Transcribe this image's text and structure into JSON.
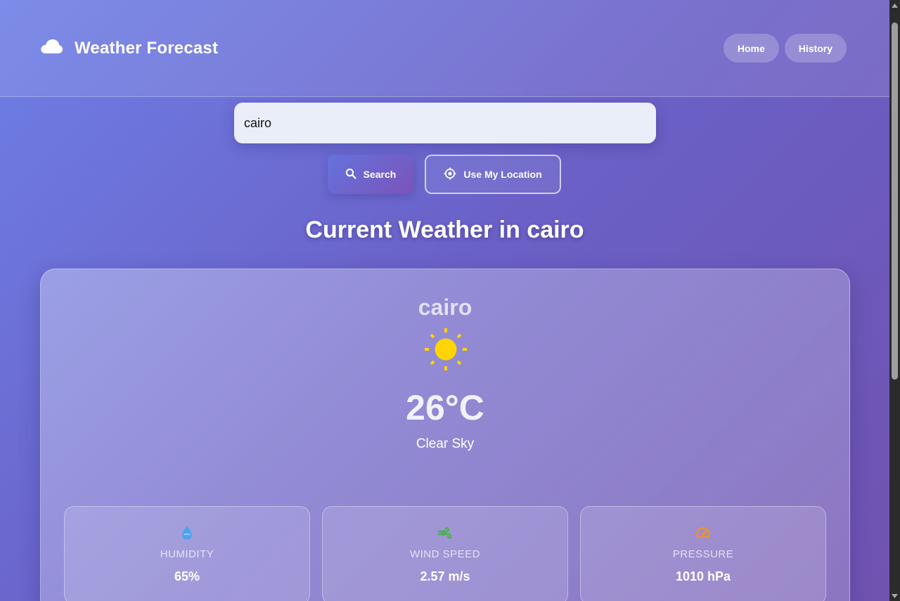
{
  "header": {
    "title": "Weather Forecast",
    "logo_icon": "cloud-icon",
    "nav": [
      {
        "label": "Home"
      },
      {
        "label": "History"
      }
    ]
  },
  "search": {
    "value": "cairo",
    "search_label": "Search",
    "location_label": "Use My Location"
  },
  "heading": "Current Weather in cairo",
  "current": {
    "city": "cairo",
    "icon": "sun-icon",
    "temperature": "26°C",
    "description": "Clear Sky"
  },
  "stats": [
    {
      "icon": "humidity-drop-icon",
      "label": "HUMIDITY",
      "value": "65%",
      "color": "#4aa3f0"
    },
    {
      "icon": "wind-icon",
      "label": "WIND SPEED",
      "value": "2.57 m/s",
      "color": "#4caf50"
    },
    {
      "icon": "gauge-icon",
      "label": "PRESSURE",
      "value": "1010 hPa",
      "color": "#f5931e"
    }
  ],
  "colors": {
    "sun": "#ffd400",
    "accent_start": "#6572dd",
    "accent_end": "#7a54b8"
  }
}
